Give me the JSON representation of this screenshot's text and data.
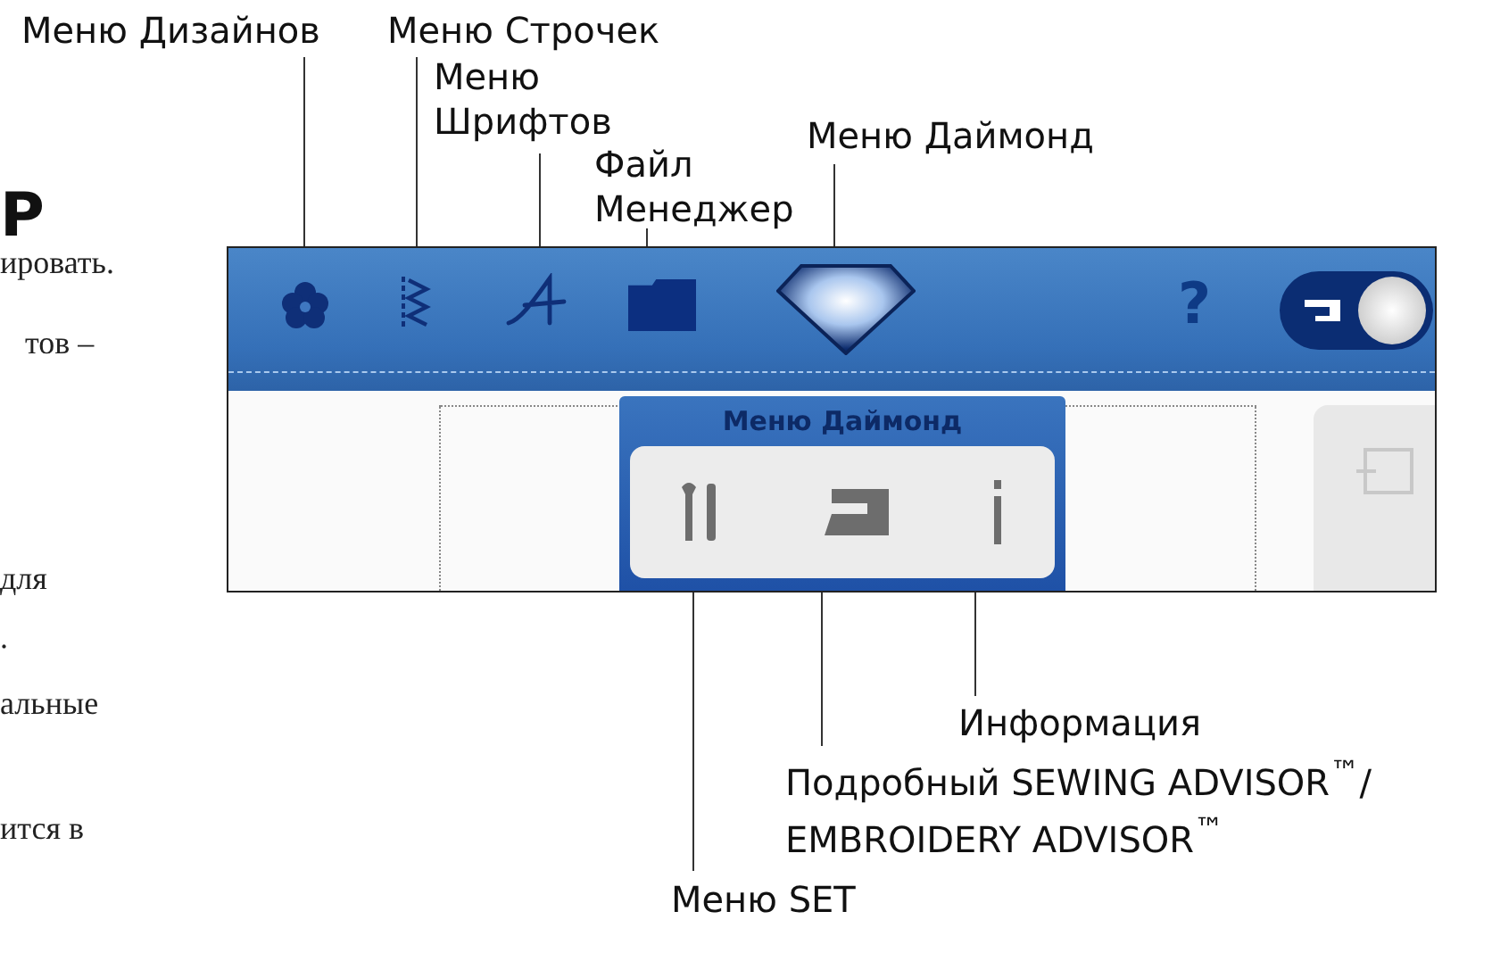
{
  "page_text": {
    "heading": "P",
    "lines": [
      "ировать.",
      "тов –",
      "для",
      ".",
      "альные",
      "ится в"
    ]
  },
  "screen": {
    "help": "?",
    "toggle": {
      "on": true
    },
    "popup": {
      "title": "Меню Даймонд"
    }
  },
  "callouts": [
    {
      "text": "Меню Дизайнов"
    },
    {
      "text": "Меню Строчек"
    },
    {
      "text": "Меню\nШрифтов"
    },
    {
      "text": "Файл\nМенеджер"
    },
    {
      "text": "Меню Даймонд"
    },
    {
      "text": "Информация"
    },
    {
      "text": "Подробный SEWING ADVISOR$^{™}$/\nEMBROIDERY ADVISOR$^{™}$"
    },
    {
      "text": "Меню SET"
    }
  ]
}
